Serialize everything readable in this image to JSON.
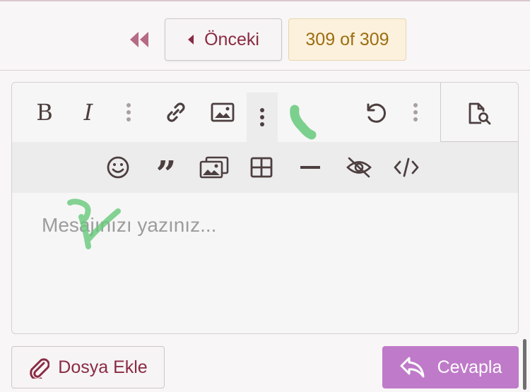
{
  "pagination": {
    "prev_label": "Önceki",
    "indicator": "309 of 309"
  },
  "toolbar": {
    "row1": [
      {
        "name": "bold",
        "icon": "bold-icon"
      },
      {
        "name": "italic",
        "icon": "italic-icon"
      },
      {
        "name": "more-text",
        "icon": "vertical-ellipsis-icon"
      },
      {
        "name": "link",
        "icon": "link-icon"
      },
      {
        "name": "image",
        "icon": "image-icon"
      },
      {
        "name": "more-insert",
        "icon": "vertical-ellipsis-icon"
      },
      {
        "name": "undo",
        "icon": "undo-icon"
      },
      {
        "name": "more-misc",
        "icon": "vertical-ellipsis-icon"
      },
      {
        "name": "preview",
        "icon": "document-search-icon"
      }
    ],
    "row2": [
      {
        "name": "emoji",
        "icon": "smiley-icon"
      },
      {
        "name": "quote",
        "icon": "quote-icon"
      },
      {
        "name": "gallery",
        "icon": "gallery-icon"
      },
      {
        "name": "table",
        "icon": "table-icon"
      },
      {
        "name": "horizontal-line",
        "icon": "horizontal-line-icon"
      },
      {
        "name": "spoiler",
        "icon": "eye-slash-icon"
      },
      {
        "name": "code",
        "icon": "code-icon"
      }
    ]
  },
  "editor": {
    "placeholder": "Mesajınızı yazınız..."
  },
  "actions": {
    "attach_label": "Dosya Ekle",
    "reply_label": "Cevapla"
  },
  "colors": {
    "brand": "#8a2a44",
    "accent_button": "#bf7ac9",
    "page_indicator_bg": "#fcf1dc",
    "page_indicator_text": "#9b6e12",
    "annotation_green": "#66c97a"
  }
}
